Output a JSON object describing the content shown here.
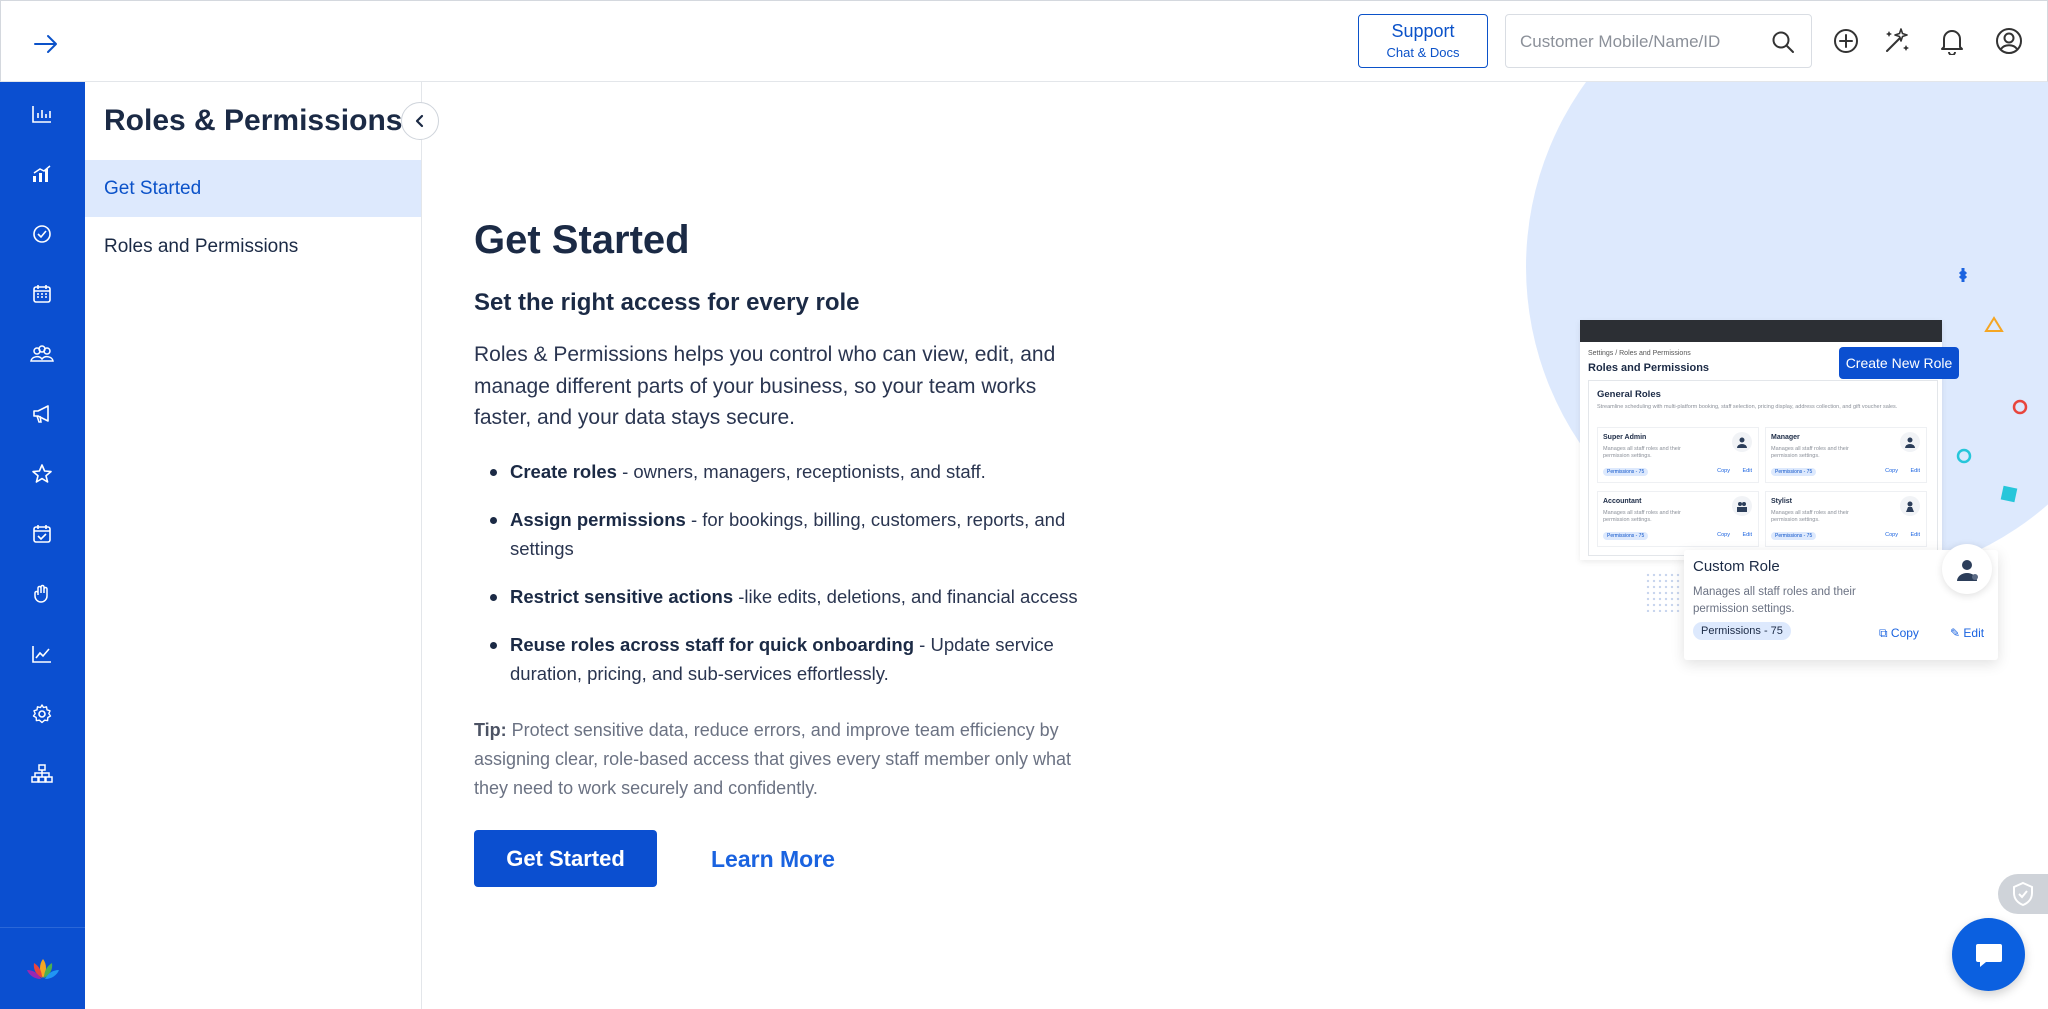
{
  "topbar": {
    "expand_icon": "arrow-right-icon",
    "support_title": "Support",
    "support_subtitle": "Chat & Docs",
    "search_placeholder": "Customer Mobile/Name/ID",
    "icons": [
      "plus-circle-icon",
      "magic-sparkle-icon",
      "bell-icon",
      "user-circle-icon"
    ]
  },
  "rail": {
    "items": [
      "bar-chart-icon",
      "signal-bars-icon",
      "check-circle-icon",
      "calendar-icon",
      "group-icon",
      "megaphone-icon",
      "star-icon",
      "calendar-check-icon",
      "hand-icon",
      "trend-icon",
      "settings-gear-icon",
      "org-chart-icon"
    ],
    "logo": "lotus-logo-icon"
  },
  "subnav": {
    "title": "Roles & Permissions",
    "items": [
      {
        "label": "Get Started",
        "active": true
      },
      {
        "label": "Roles and Permissions",
        "active": false
      }
    ]
  },
  "main": {
    "title": "Get Started",
    "subtitle": "Set the right access for every role",
    "intro": "Roles & Permissions helps you control who can view, edit, and manage different parts of your business, so your team works faster, and your data stays secure.",
    "bullets": [
      {
        "bold": "Create roles",
        "text": " - owners, managers, receptionists, and staff."
      },
      {
        "bold": "Assign permissions",
        "text": " - for bookings, billing, customers, reports, and settings"
      },
      {
        "bold": "Restrict sensitive actions",
        "text": " -like edits, deletions, and financial access"
      },
      {
        "bold": "Reuse roles across staff for quick onboarding",
        "text": " - Update service duration, pricing, and sub-services effortlessly."
      }
    ],
    "tip_label": "Tip:",
    "tip_text": " Protect sensitive data, reduce errors, and improve team efficiency by assigning clear, role-based access that gives every staff member only what they need to work securely and confidently.",
    "primary_button": "Get Started",
    "secondary_link": "Learn More"
  },
  "illustration": {
    "breadcrumb": "Settings  /  Roles and Permissions",
    "title": "Roles and Permissions",
    "create_button": "Create New Role",
    "group_title": "General Roles",
    "group_desc": "Streamline scheduling with multi-platform booking, staff selection, pricing display, address collection, and gift voucher sales.",
    "roles": [
      {
        "name": "Super Admin",
        "desc": "Manages all staff roles and their permission settings.",
        "perm": "Permissions - 75",
        "copy": "Copy",
        "edit": "Edit"
      },
      {
        "name": "Manager",
        "desc": "Manages all staff roles and their permission settings.",
        "perm": "Permissions - 75",
        "copy": "Copy",
        "edit": "Edit"
      },
      {
        "name": "Accountant",
        "desc": "Manages all staff roles and their permission settings.",
        "perm": "Permissions - 75",
        "copy": "Copy",
        "edit": "Edit"
      },
      {
        "name": "Stylist",
        "desc": "Manages all staff roles and their permission settings.",
        "perm": "Permissions - 75",
        "copy": "Copy",
        "edit": "Edit"
      }
    ],
    "custom": {
      "name": "Custom Role",
      "desc": "Manages all staff roles and their permission settings.",
      "perm": "Permissions - 75",
      "copy": "Copy",
      "edit": "Edit"
    }
  },
  "widgets": {
    "shield_icon": "shield-check-icon",
    "chat_icon": "chat-bubble-icon"
  },
  "colors": {
    "primary": "#0b4fd0",
    "accent_light": "#dde9fd",
    "text_dark": "#1b2a45",
    "link": "#1a63e0"
  }
}
